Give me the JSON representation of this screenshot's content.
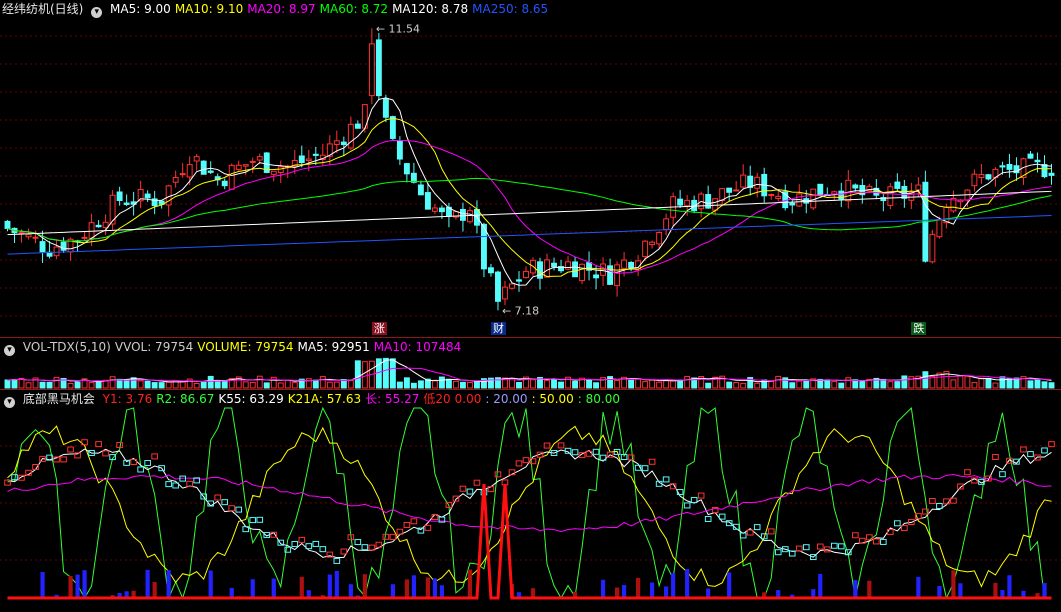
{
  "price_panel": {
    "title": "经纬纺机(日线)",
    "collapse_glyph": "▾",
    "indicators": [
      {
        "label": "MA5: 9.00",
        "color": "#ffffff"
      },
      {
        "label": "MA10: 9.10",
        "color": "#ffff00"
      },
      {
        "label": "MA20: 8.97",
        "color": "#ff00ff"
      },
      {
        "label": "MA60: 8.72",
        "color": "#00ff00"
      },
      {
        "label": "MA120: 8.78",
        "color": "#ffffff"
      },
      {
        "label": "MA250: 8.65",
        "color": "#2255ff"
      }
    ],
    "high_label": "11.54",
    "low_label": "7.18",
    "markers": [
      {
        "text": "涨",
        "bg": "#8a1020",
        "color": "#ffffff"
      },
      {
        "text": "财",
        "bg": "#0a2a8a",
        "color": "#ffffff"
      },
      {
        "text": "跌",
        "bg": "#0a5a1a",
        "color": "#ffffff"
      }
    ]
  },
  "volume_panel": {
    "collapse_glyph": "▾",
    "indicators": [
      {
        "label": "VOL-TDX(5,10)",
        "color": "#cccccc"
      },
      {
        "label": "VVOL: 79754",
        "color": "#cccccc"
      },
      {
        "label": "VOLUME: 79754",
        "color": "#ffff00"
      },
      {
        "label": "MA5: 92951",
        "color": "#ffffff"
      },
      {
        "label": "MA10: 107484",
        "color": "#ff00ff"
      }
    ]
  },
  "osc_panel": {
    "collapse_glyph": "▾",
    "title": "底部黑马机会",
    "indicators": [
      {
        "label": "Y1: 3.76",
        "color": "#ff2020"
      },
      {
        "label": "R2: 86.67",
        "color": "#33ff33"
      },
      {
        "label": "K55: 63.29",
        "color": "#ffffff"
      },
      {
        "label": "K21A: 57.63",
        "color": "#ffff00"
      },
      {
        "label": "长: 55.27",
        "color": "#ff00ff"
      },
      {
        "label": "低20",
        "color": "#ff2020"
      },
      {
        "label": "0.00",
        "color": "#ff2020"
      },
      {
        "label": ": 20.00",
        "color": "#9999ff"
      },
      {
        "label": ": 50.00",
        "color": "#ffff00"
      },
      {
        "label": ": 80.00",
        "color": "#33ff33"
      }
    ]
  },
  "colors": {
    "up": "#ff3232",
    "down": "#54fcfc",
    "grid": "#6a0000",
    "separator": "#8a1a1a"
  },
  "chart_data": [
    {
      "type": "candlestick",
      "title": "经纬纺机(日线)",
      "ylim": [
        7.0,
        11.7
      ],
      "high": 11.54,
      "low": 7.18,
      "ma_last": {
        "MA5": 9.0,
        "MA10": 9.1,
        "MA20": 8.97,
        "MA60": 8.72,
        "MA120": 8.78,
        "MA250": 8.65
      },
      "x_count": 150
    },
    {
      "type": "bar",
      "title": "VOL-TDX(5,10)",
      "last_volume": 79754,
      "ma5": 92951,
      "ma10": 107484
    },
    {
      "type": "line",
      "title": "底部黑马机会",
      "ylim": [
        0,
        100
      ],
      "reference_levels": [
        20,
        50,
        80
      ],
      "last_values": {
        "Y1": 3.76,
        "R2": 86.67,
        "K55": 63.29,
        "K21A": 57.63,
        "长": 55.27
      }
    }
  ]
}
